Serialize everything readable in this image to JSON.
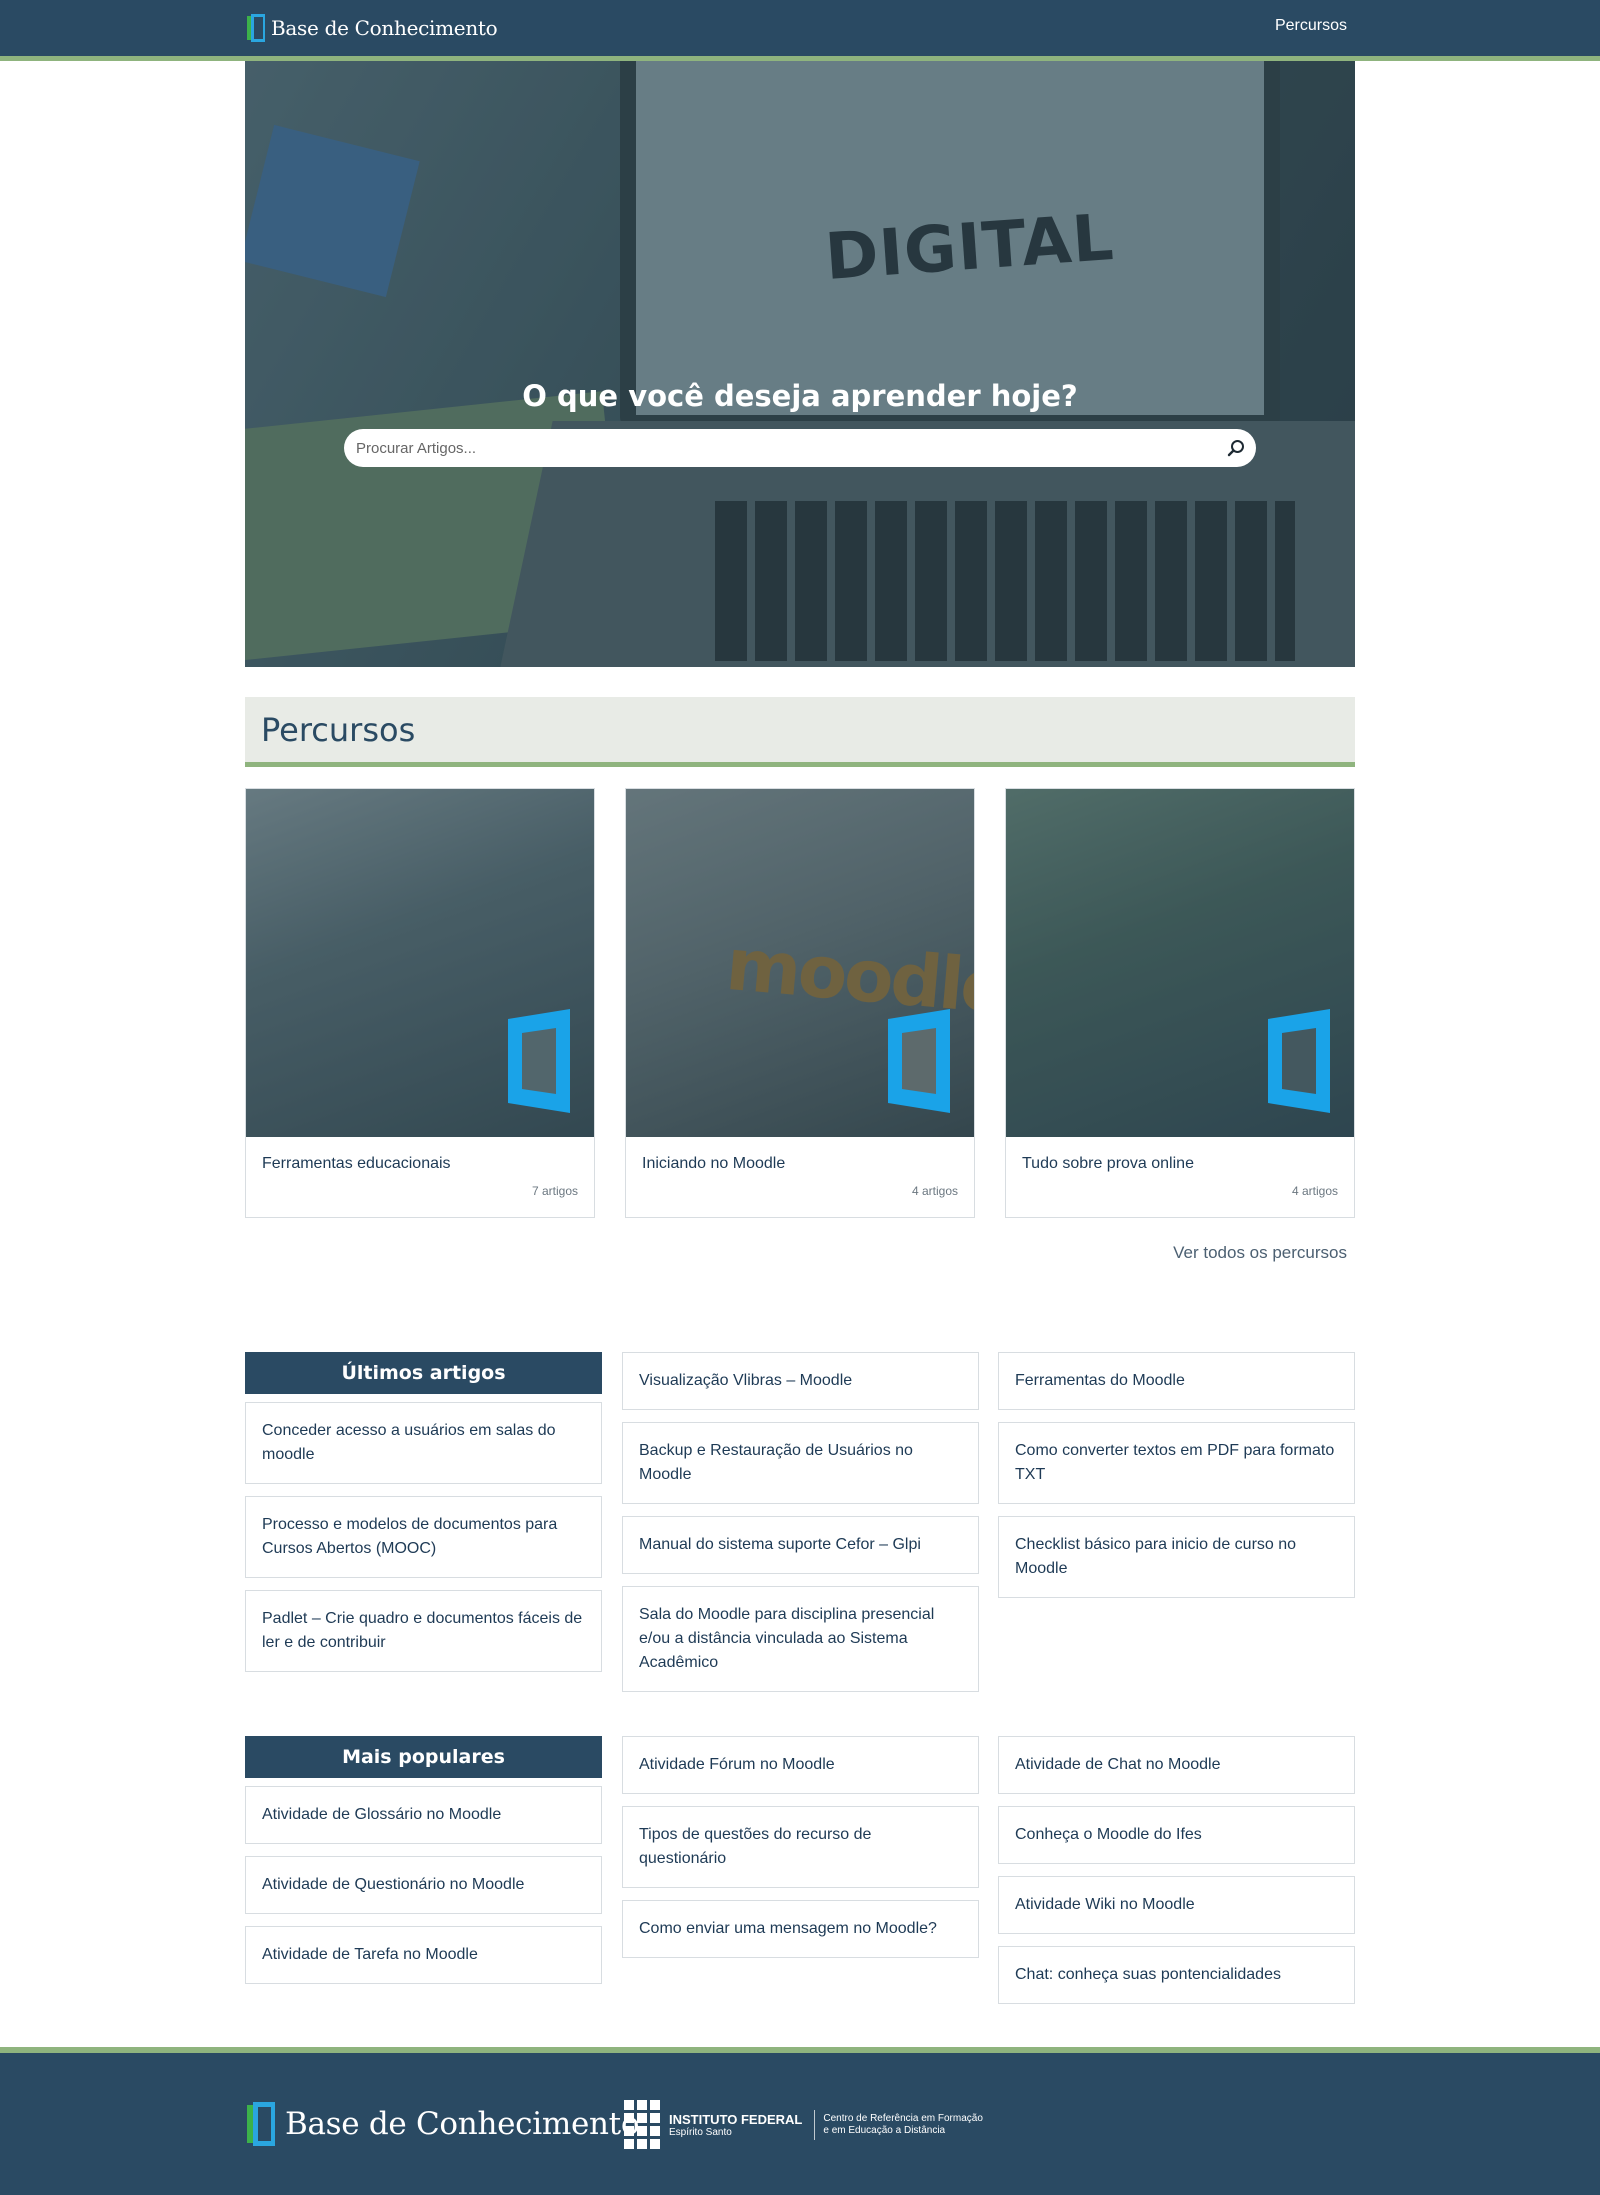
{
  "header": {
    "brand": "Base de Conhecimento",
    "nav_item": "Percursos"
  },
  "hero": {
    "title": "O que você deseja aprender hoje?",
    "search_placeholder": "Procurar Artigos..."
  },
  "percursos": {
    "heading": "Percursos",
    "cards": [
      {
        "title": "Ferramentas educacionais",
        "count": "7 artigos"
      },
      {
        "title": "Iniciando no Moodle",
        "count": "4 artigos"
      },
      {
        "title": "Tudo sobre prova online",
        "count": "4 artigos"
      }
    ],
    "see_all": "Ver todos os percursos"
  },
  "ultimos": {
    "label": "Últimos artigos",
    "col1": [
      "Conceder acesso a usuários em salas do moodle",
      "Processo e modelos de documentos para Cursos Abertos (MOOC)",
      "Padlet – Crie quadro e documentos fáceis de ler e de contribuir"
    ],
    "col2": [
      "Visualização Vlibras – Moodle",
      "Backup e Restauração de Usuários no Moodle",
      "Manual do sistema suporte Cefor – Glpi",
      "Sala do Moodle para disciplina presencial e/ou a distância vinculada ao Sistema Acadêmico"
    ],
    "col3": [
      "Ferramentas do Moodle",
      "Como converter textos em PDF para formato TXT",
      "Checklist básico para inicio de curso no Moodle"
    ]
  },
  "populares": {
    "label": "Mais populares",
    "col1": [
      "Atividade de Glossário no Moodle",
      "Atividade de Questionário no Moodle",
      "Atividade de Tarefa no Moodle"
    ],
    "col2": [
      "Atividade Fórum no Moodle",
      "Tipos de questões do recurso de questionário",
      "Como enviar uma mensagem no Moodle?"
    ],
    "col3": [
      "Atividade de Chat no Moodle",
      "Conheça o Moodle do Ifes",
      "Atividade Wiki no Moodle",
      "Chat: conheça suas pontencialidades"
    ]
  },
  "footer": {
    "brand": "Base de Conhecimento",
    "institute": "INSTITUTO FEDERAL",
    "campus": "Espírito Santo",
    "center_line1": "Centro de Referência em Formação",
    "center_line2": "e em Educação a Distância"
  },
  "colors": {
    "primary": "#2a4a63",
    "accent_green": "#8fb47e",
    "logo_blue": "#2aa6e0"
  }
}
